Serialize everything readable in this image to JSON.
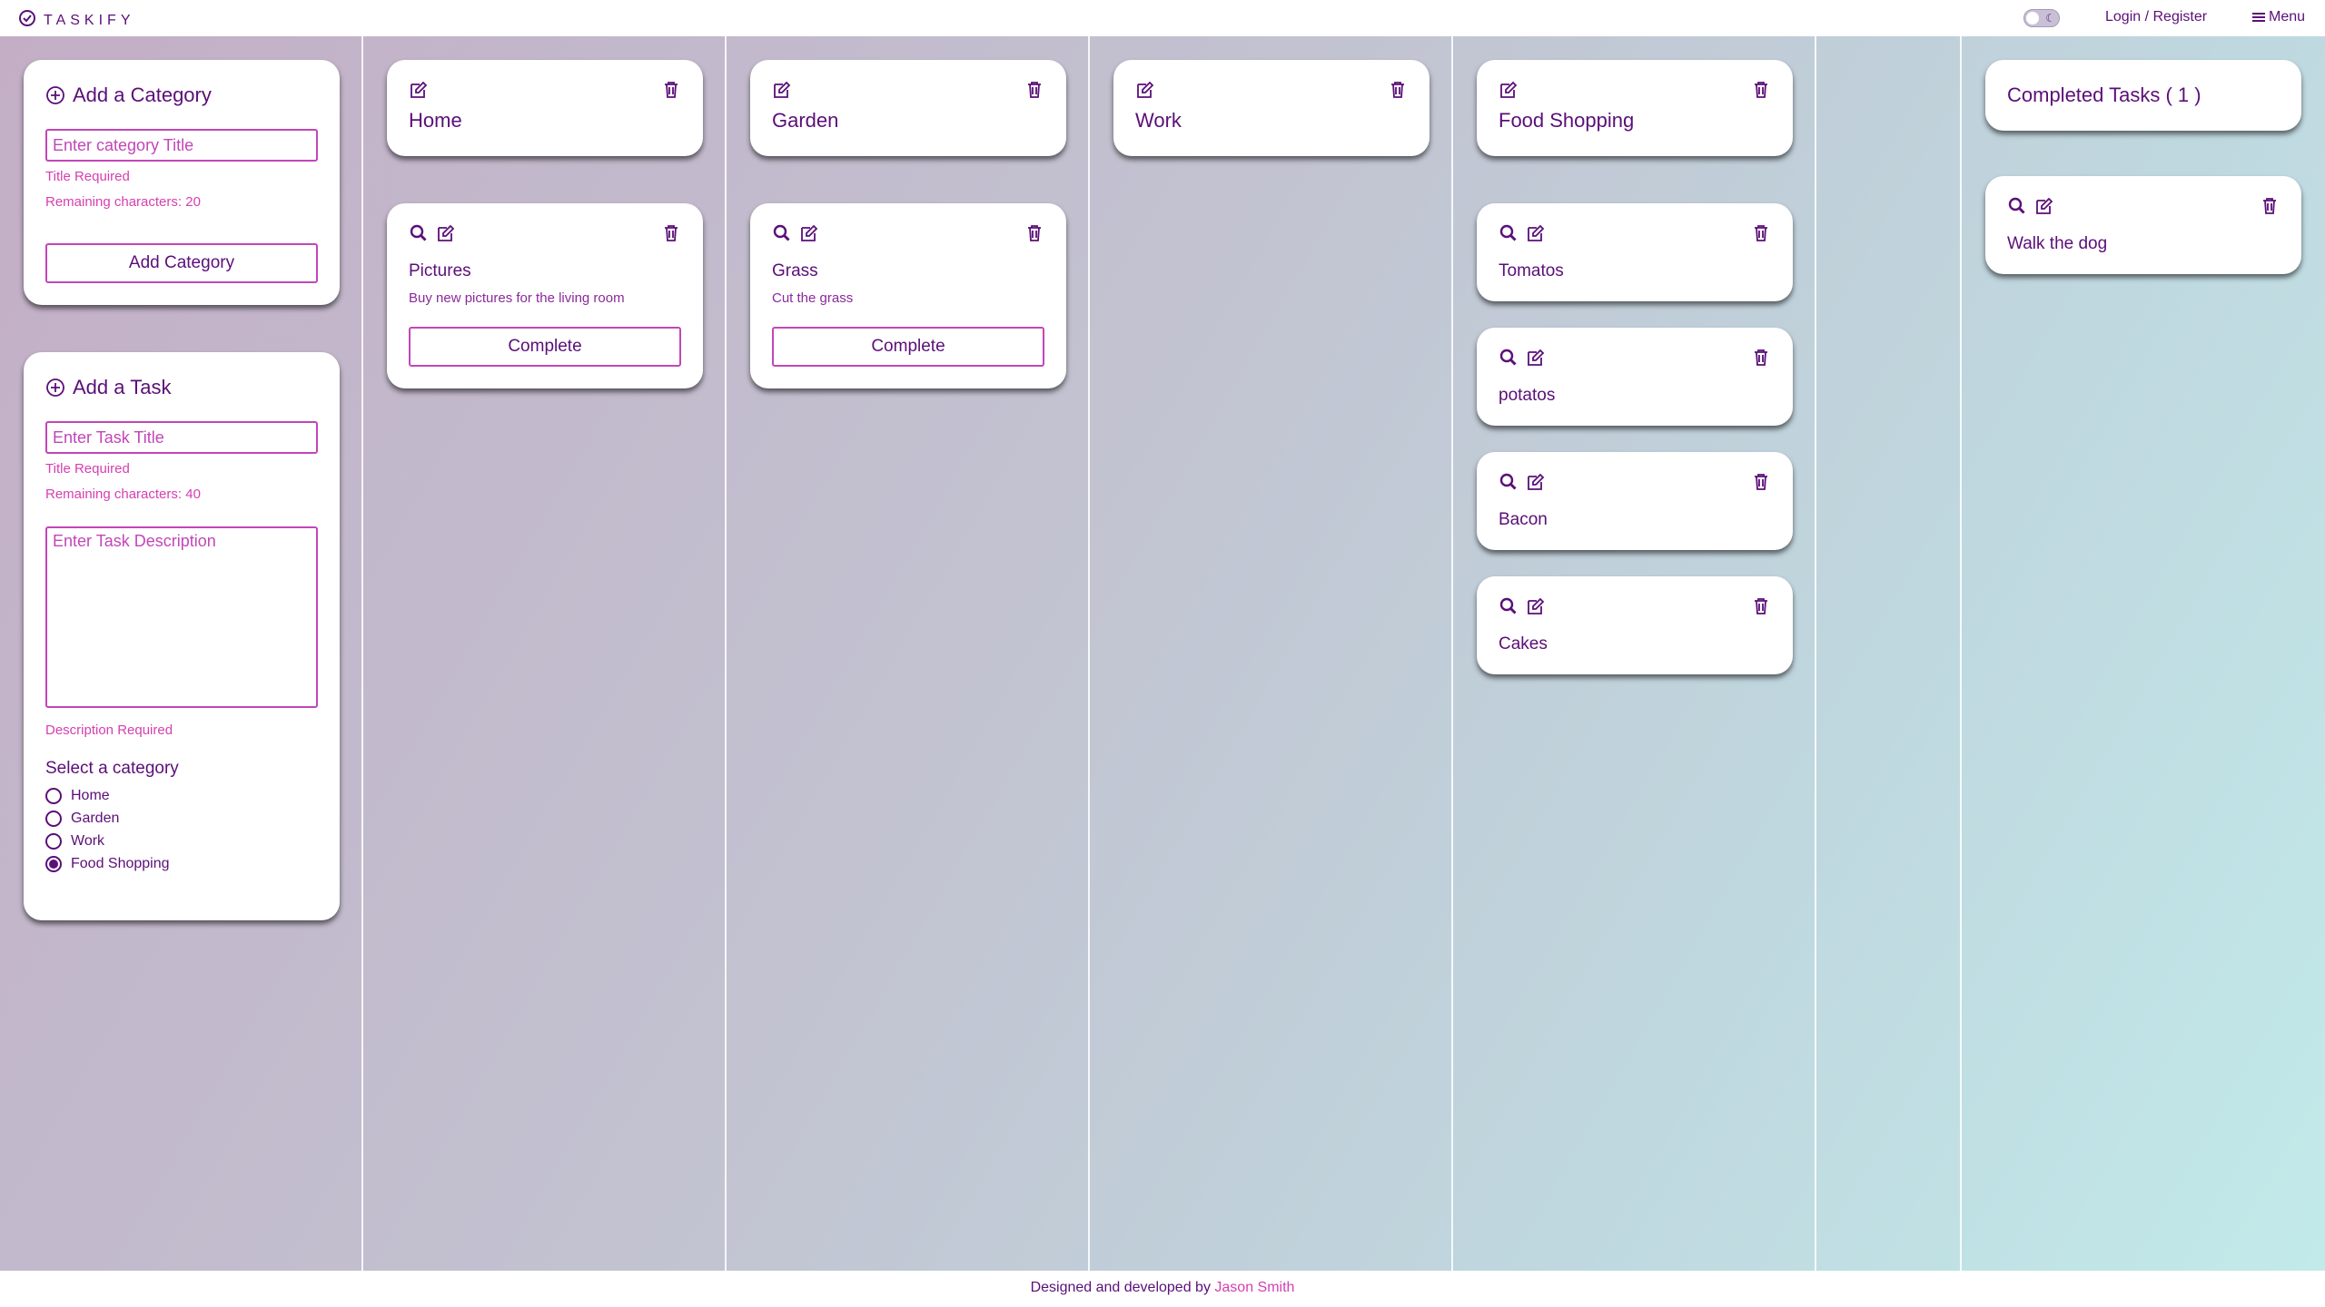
{
  "header": {
    "logo_text": "TASKIFY",
    "login_label": "Login / Register",
    "menu_label": "Menu"
  },
  "add_category": {
    "title": "Add a Category",
    "placeholder": "Enter category Title",
    "error": "Title Required",
    "remaining": "Remaining characters: 20",
    "button": "Add Category"
  },
  "add_task": {
    "title": "Add a Task",
    "title_placeholder": "Enter Task Title",
    "title_error": "Title Required",
    "remaining": "Remaining characters: 40",
    "desc_placeholder": "Enter Task Description",
    "desc_error": "Description Required",
    "select_label": "Select a category",
    "options": [
      "Home",
      "Garden",
      "Work",
      "Food Shopping"
    ],
    "selected": "Food Shopping"
  },
  "categories": [
    {
      "name": "Home",
      "tasks": [
        {
          "title": "Pictures",
          "description": "Buy new pictures for the living room",
          "button": "Complete"
        }
      ]
    },
    {
      "name": "Garden",
      "tasks": [
        {
          "title": "Grass",
          "description": "Cut the grass",
          "button": "Complete"
        }
      ]
    },
    {
      "name": "Work",
      "tasks": []
    },
    {
      "name": "Food Shopping",
      "tasks": [
        {
          "title": "Tomatos"
        },
        {
          "title": "potatos"
        },
        {
          "title": "Bacon"
        },
        {
          "title": "Cakes"
        }
      ]
    }
  ],
  "completed": {
    "title": "Completed Tasks ( 1 )",
    "tasks": [
      {
        "title": "Walk the dog"
      }
    ]
  },
  "footer": {
    "text": "Designed and developed by",
    "author": "Jason Smith"
  },
  "colors": {
    "primary": "#5b0f78",
    "accent": "#d63fb0",
    "border": "#c246b8"
  }
}
